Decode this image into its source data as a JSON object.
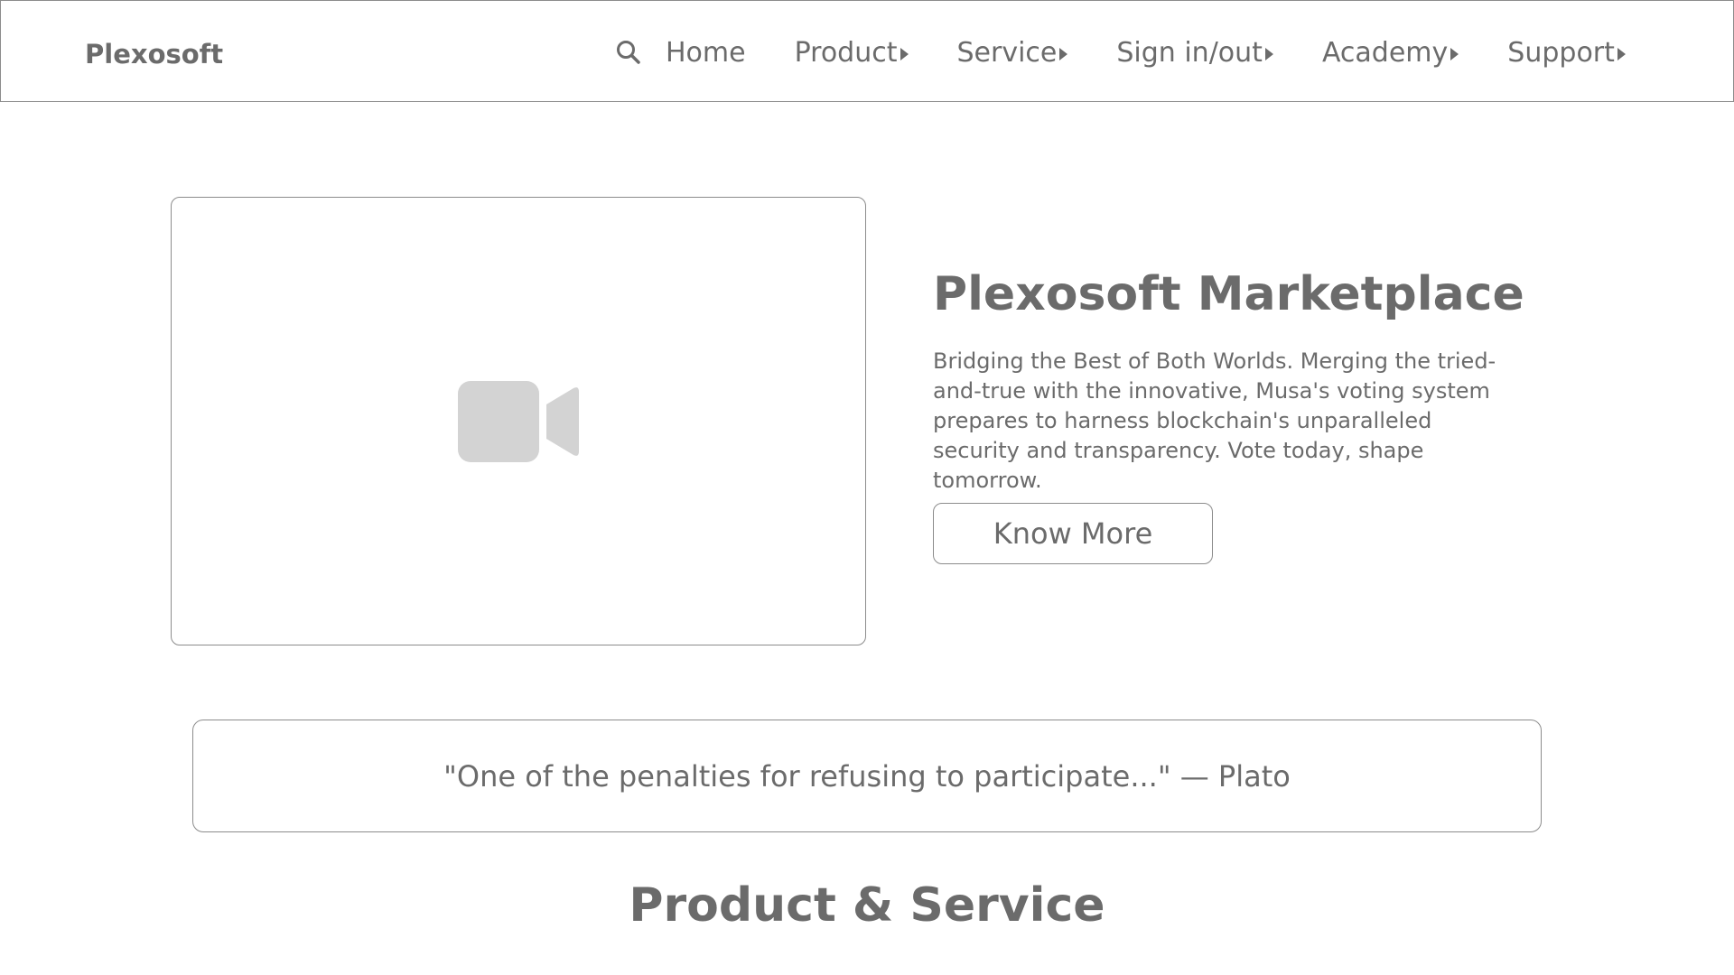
{
  "header": {
    "brand": "Plexosoft",
    "search_icon": "search-icon",
    "nav": [
      {
        "label": "Home",
        "has_submenu": false
      },
      {
        "label": "Product",
        "has_submenu": true
      },
      {
        "label": "Service",
        "has_submenu": true
      },
      {
        "label": "Sign in/out",
        "has_submenu": true
      },
      {
        "label": "Academy",
        "has_submenu": true
      },
      {
        "label": "Support",
        "has_submenu": true
      }
    ]
  },
  "hero": {
    "media_icon": "video-camera-icon",
    "title": "Plexosoft Marketplace",
    "description": "Bridging the Best of Both Worlds. Merging the tried-and-true with the innovative, Musa's voting system prepares to harness blockchain's unparalleled security and transparency. Vote today, shape tomorrow.",
    "button_label": "Know More"
  },
  "quote": {
    "text": "\"One of the penalties for refusing to participate...\" — Plato"
  },
  "section": {
    "title": "Product & Service"
  },
  "colors": {
    "text": "#6b6b6b",
    "border": "#8c8c8c",
    "icon": "#d3d3d3",
    "background": "#ffffff"
  }
}
